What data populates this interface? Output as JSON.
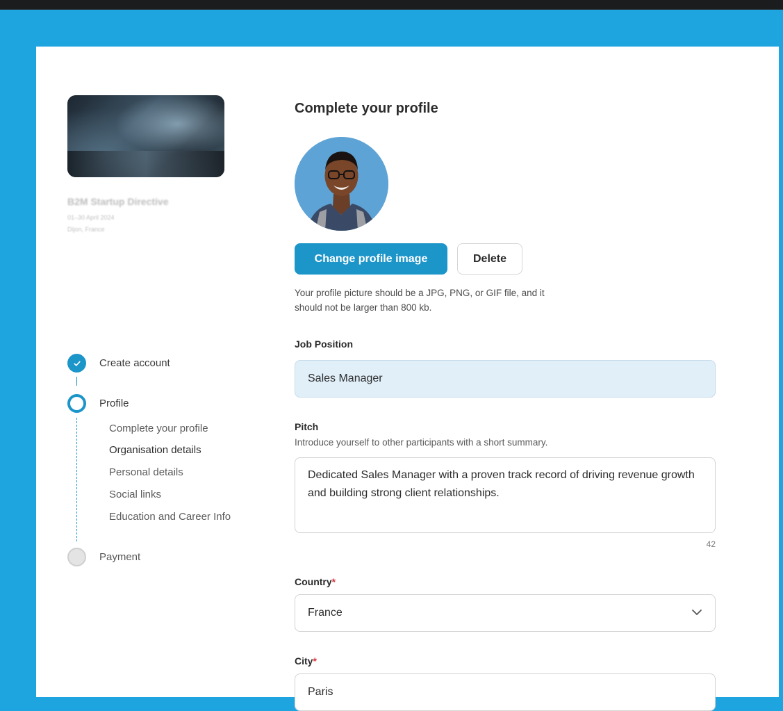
{
  "event": {
    "title": "B2M Startup Directive",
    "date": "01–30 April 2024",
    "location": "Dijon, France"
  },
  "steps": [
    {
      "label": "Create account",
      "state": "done",
      "icon": "check-icon"
    },
    {
      "label": "Profile",
      "state": "active",
      "icon": "ring-icon"
    },
    {
      "label": "Payment",
      "state": "todo",
      "icon": "circle-icon"
    }
  ],
  "substeps": [
    {
      "label": "Complete your profile"
    },
    {
      "label": "Organisation details"
    },
    {
      "label": "Personal details"
    },
    {
      "label": "Social links"
    },
    {
      "label": "Education and Career Info"
    }
  ],
  "form": {
    "heading": "Complete your profile",
    "change_image_label": "Change profile image",
    "delete_label": "Delete",
    "image_help": "Your profile picture should be a JPG, PNG, or GIF file, and it should not be larger than 800 kb.",
    "job_position": {
      "label": "Job Position",
      "value": "Sales Manager"
    },
    "pitch": {
      "label": "Pitch",
      "help": "Introduce yourself to other participants with a short summary.",
      "value": "Dedicated Sales Manager with a proven track record of driving revenue growth and building strong client relationships.",
      "counter": "42"
    },
    "country": {
      "label": "Country",
      "required_mark": "*",
      "value": "France",
      "icon": "chevron-down-icon"
    },
    "city": {
      "label": "City",
      "required_mark": "*",
      "value": "Paris"
    }
  },
  "colors": {
    "background": "#1ea5e0",
    "accent": "#1c95c9",
    "filled_field": "#e1eff9",
    "required": "#d9363e"
  }
}
